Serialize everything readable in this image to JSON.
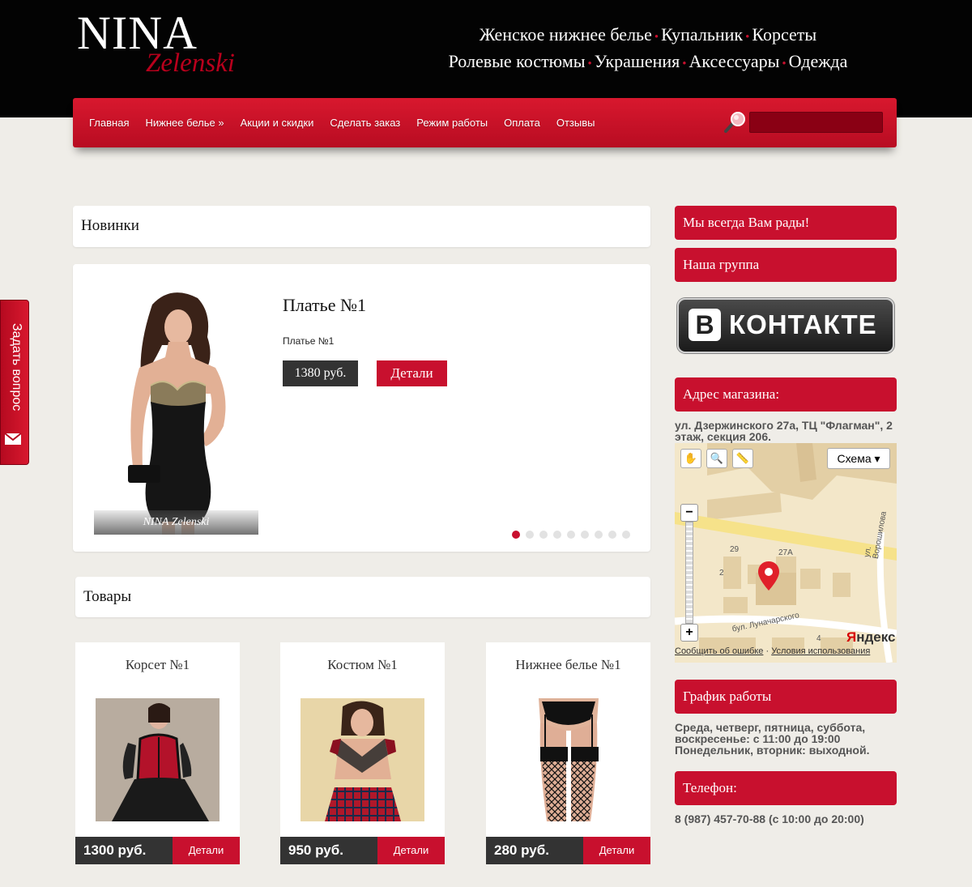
{
  "header": {
    "logo_main": "NINA",
    "logo_sub": "Zelenski",
    "categories_line1": [
      "Женское нижнее белье",
      "Купальник",
      "Корсеты"
    ],
    "categories_line2": [
      "Ролевые костюмы",
      "Украшения",
      "Аксессуары",
      "Одежда"
    ]
  },
  "nav": {
    "items": [
      "Главная",
      "Нижнее белье »",
      "Акции и скидки",
      "Сделать заказ",
      "Режим работы",
      "Оплата",
      "Отзывы"
    ],
    "search_placeholder": ""
  },
  "side_tab": {
    "label": "Задать вопрос",
    "icon": "envelope-icon"
  },
  "new_section": {
    "title": "Новинки",
    "slide": {
      "image_caption": "NINA Zelenski",
      "title": "Платье №1",
      "description": "Платье №1",
      "price": "1380 руб.",
      "details": "Детали"
    },
    "dots_count": 9,
    "active_dot": 0
  },
  "products_section": {
    "title": "Товары",
    "items": [
      {
        "title": "Корсет №1",
        "price": "1300 руб.",
        "details": "Детали"
      },
      {
        "title": "Костюм №1",
        "price": "950 руб.",
        "details": "Детали"
      },
      {
        "title": "Нижнее белье №1",
        "price": "280 руб.",
        "details": "Детали"
      }
    ]
  },
  "sidebar": {
    "welcome": "Мы всегда Вам рады!",
    "group_title": "Наша группа",
    "vk_label": "КОНТАКТЕ",
    "vk_letter": "В",
    "address_title": "Адрес магазина:",
    "address_text": "ул. Дзержинского 27а, ТЦ \"Флагман\", 2 этаж, секция 206.",
    "map": {
      "scheme_label": "Схема ▾",
      "street_label": "бул. Луначарского",
      "street_label2": "ул. Ворошилова",
      "building_labels": [
        "29",
        "27А",
        "2",
        "4"
      ],
      "yandex_y": "Я",
      "yandex_rest": "ндекс",
      "report_error": "Сообщить об ошибке",
      "terms": "Условия использования",
      "footer_sep": " · "
    },
    "schedule_title": "График работы",
    "schedule_text": "Среда, четверг, пятница, суббота, воскресенье: с 11:00 до 19:00 Понедельник, вторник: выходной.",
    "phone_title": "Телефон:",
    "phone_text": "8 (987) 457-70-88 (с 10:00 до 20:00)"
  },
  "colors": {
    "accent": "#c8102e",
    "header_bg": "#030303",
    "page_bg": "#efede8",
    "price_bg": "#333333"
  }
}
